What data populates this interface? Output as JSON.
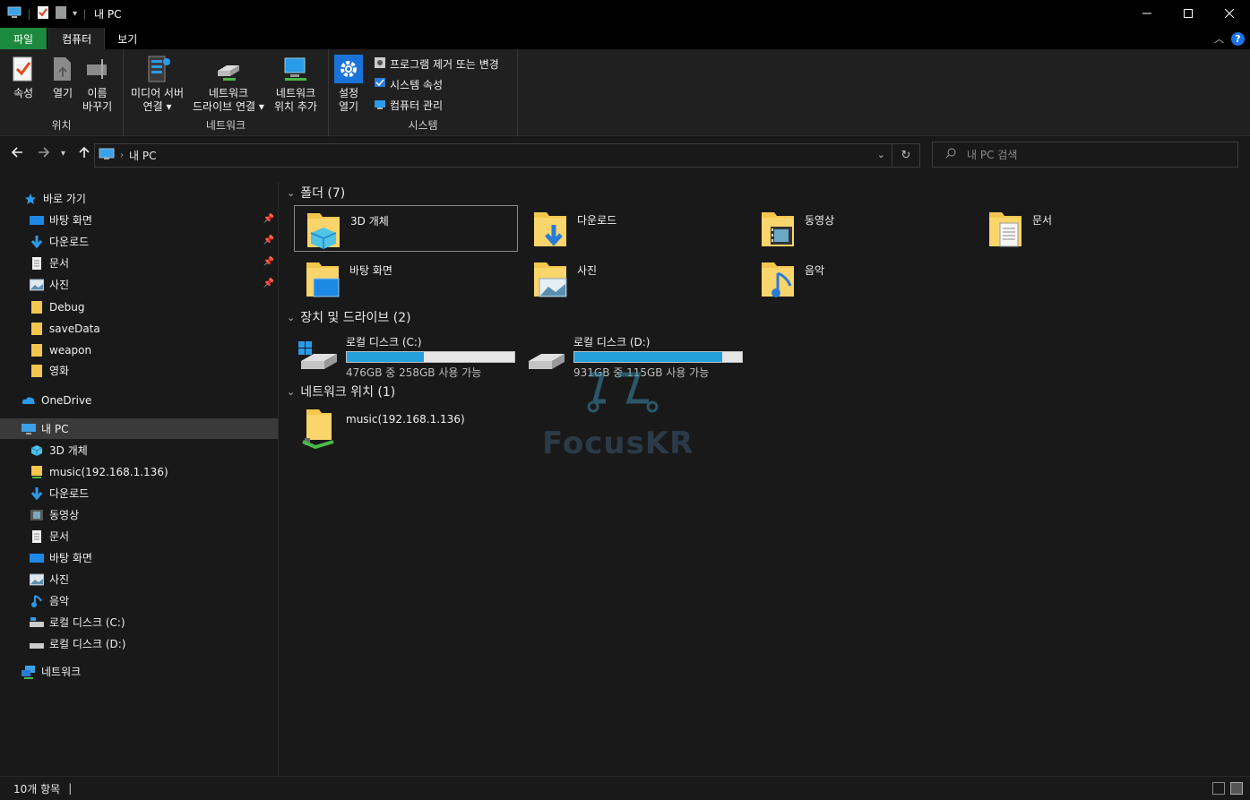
{
  "window": {
    "title": "내 PC",
    "controls": [
      "minimize-icon",
      "maximize-icon",
      "close-icon"
    ]
  },
  "ribbon_tabs": [
    {
      "label": "파일",
      "active": false
    },
    {
      "label": "컴퓨터",
      "active": true
    },
    {
      "label": "보기",
      "active": false
    }
  ],
  "ribbon": {
    "groups": {
      "location": {
        "label": "위치",
        "buttons": [
          {
            "label": "속성"
          },
          {
            "label": "열기"
          },
          {
            "label": "이름\n바꾸기"
          }
        ]
      },
      "network": {
        "label": "네트워크",
        "buttons": [
          {
            "label": "미디어 서버\n연결 ▾"
          },
          {
            "label": "네트워크\n드라이브 연결 ▾"
          },
          {
            "label": "네트워크\n위치 추가"
          }
        ]
      },
      "system": {
        "label": "시스템",
        "open_settings": "설정\n열기",
        "small_buttons": [
          {
            "label": "프로그램 제거 또는 변경"
          },
          {
            "label": "시스템 속성"
          },
          {
            "label": "컴퓨터 관리"
          }
        ]
      }
    }
  },
  "address": {
    "path": "내 PC",
    "search_placeholder": "내 PC 검색"
  },
  "sidebar": {
    "quick_access": {
      "label": "바로 가기"
    },
    "quick_items": [
      {
        "label": "바탕 화면",
        "pinned": true,
        "icon": "desktop-icon"
      },
      {
        "label": "다운로드",
        "pinned": true,
        "icon": "download-icon"
      },
      {
        "label": "문서",
        "pinned": true,
        "icon": "document-icon"
      },
      {
        "label": "사진",
        "pinned": true,
        "icon": "picture-icon"
      },
      {
        "label": "Debug",
        "pinned": false,
        "icon": "folder-icon"
      },
      {
        "label": "saveData",
        "pinned": false,
        "icon": "folder-icon"
      },
      {
        "label": "weapon",
        "pinned": false,
        "icon": "folder-icon"
      },
      {
        "label": "영화",
        "pinned": false,
        "icon": "folder-icon"
      }
    ],
    "onedrive": {
      "label": "OneDrive"
    },
    "this_pc": {
      "label": "내 PC"
    },
    "pc_items": [
      {
        "label": "3D 개체",
        "icon": "3d-objects-icon"
      },
      {
        "label": "music(192.168.1.136)",
        "icon": "network-folder-icon"
      },
      {
        "label": "다운로드",
        "icon": "download-icon"
      },
      {
        "label": "동영상",
        "icon": "video-icon"
      },
      {
        "label": "문서",
        "icon": "document-icon"
      },
      {
        "label": "바탕 화면",
        "icon": "desktop-icon"
      },
      {
        "label": "사진",
        "icon": "picture-icon"
      },
      {
        "label": "음악",
        "icon": "music-icon"
      },
      {
        "label": "로컬 디스크 (C:)",
        "icon": "drive-c-icon"
      },
      {
        "label": "로컬 디스크 (D:)",
        "icon": "drive-d-icon"
      }
    ],
    "network": {
      "label": "네트워크"
    }
  },
  "main": {
    "folders_header": "폴더 (7)",
    "folders": [
      {
        "name": "3D 개체",
        "icon": "3d-objects-icon"
      },
      {
        "name": "다운로드",
        "icon": "download-icon"
      },
      {
        "name": "동영상",
        "icon": "video-icon"
      },
      {
        "name": "문서",
        "icon": "document-icon"
      },
      {
        "name": "바탕 화면",
        "icon": "desktop-icon"
      },
      {
        "name": "사진",
        "icon": "picture-icon"
      },
      {
        "name": "음악",
        "icon": "music-icon"
      }
    ],
    "drives_header": "장치 및 드라이브 (2)",
    "drives": [
      {
        "name": "로컬 디스크 (C:)",
        "free": "476GB 중 258GB 사용 가능",
        "used_fraction": 0.46
      },
      {
        "name": "로컬 디스크 (D:)",
        "free": "931GB 중 115GB 사용 가능",
        "used_fraction": 0.88
      }
    ],
    "network_header": "네트워크 위치 (1)",
    "network_locations": [
      {
        "name": "music(192.168.1.136)",
        "icon": "network-folder-icon"
      }
    ]
  },
  "watermark": "FocusKR",
  "status": {
    "item_count": "10개 항목"
  },
  "colors": {
    "file_tab": "#1c8a3e",
    "drive_bar": "#26a0da",
    "background": "#191919"
  }
}
